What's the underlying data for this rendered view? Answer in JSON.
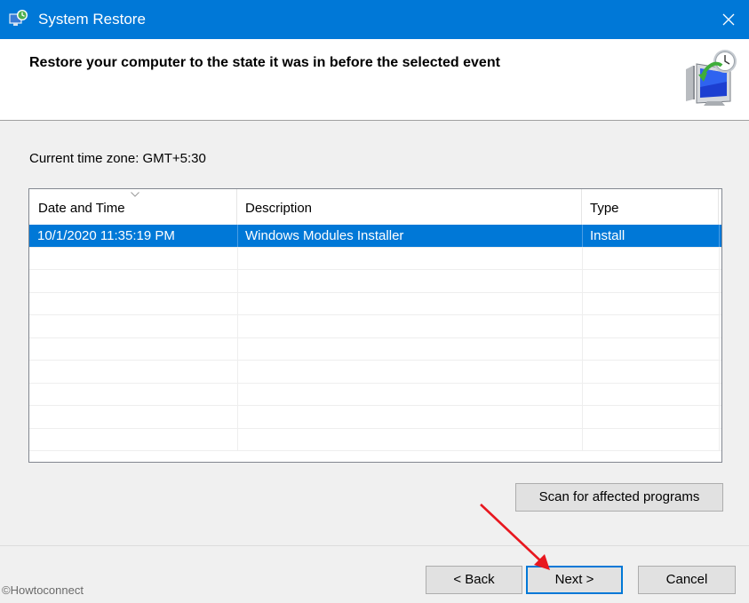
{
  "window": {
    "title": "System Restore",
    "app_icon": "system-restore-icon",
    "close_icon": "close-icon",
    "accent_color": "#0078d7"
  },
  "header": {
    "heading": "Restore your computer to the state it was in before the selected event",
    "graphic_icon": "restore-monitor-clock-icon"
  },
  "timezone": {
    "label": "Current time zone: GMT+5:30"
  },
  "restore_points": {
    "columns": [
      "Date and Time",
      "Description",
      "Type"
    ],
    "sorted_column": "Date and Time",
    "rows": [
      {
        "date_time": "10/1/2020 11:35:19 PM",
        "description": "Windows Modules Installer",
        "type": "Install",
        "selected": true
      }
    ],
    "empty_rows": 9,
    "selection_color": "#0078d7"
  },
  "buttons": {
    "scan": "Scan for affected programs",
    "back": "< Back",
    "next": "Next >",
    "cancel": "Cancel"
  },
  "annotation": {
    "arrow_color": "#e8171f",
    "points_to": "next-button"
  },
  "watermark": "©Howtoconnect"
}
